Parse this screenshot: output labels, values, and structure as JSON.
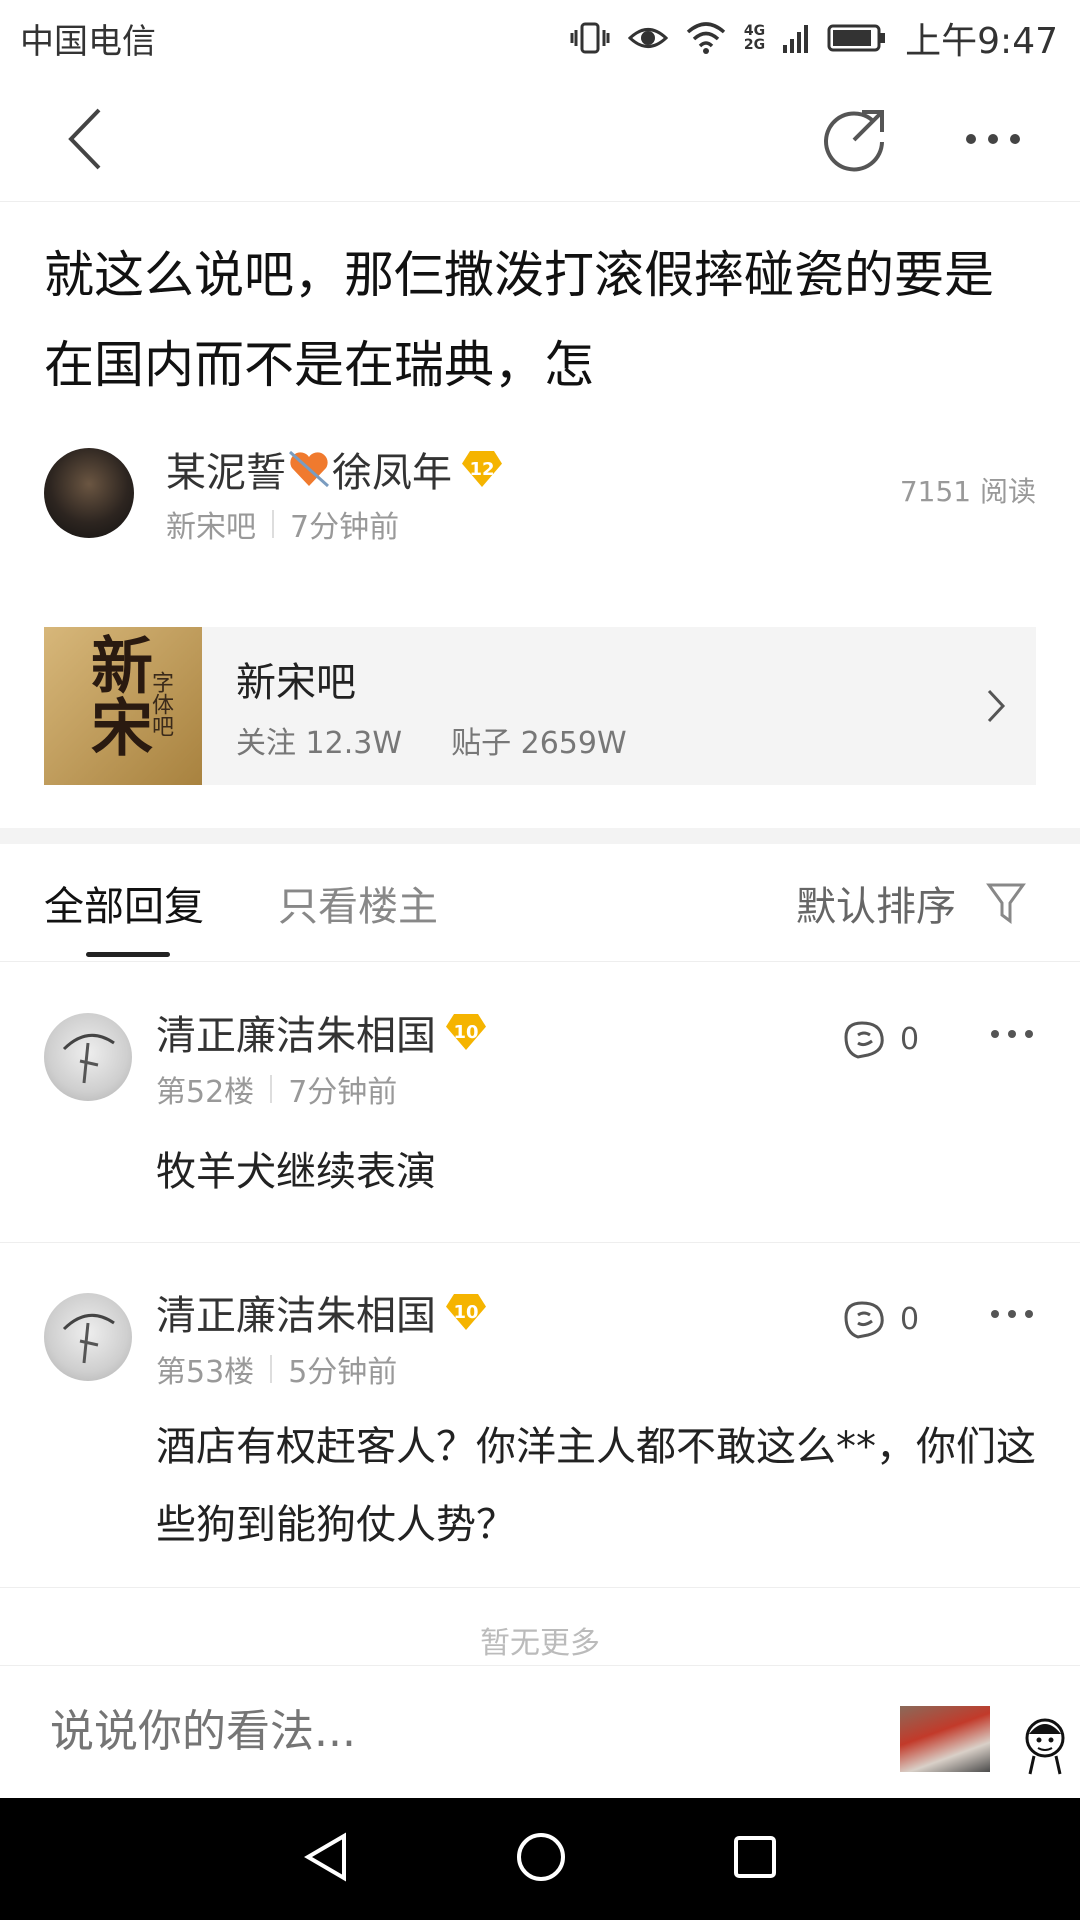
{
  "status_bar": {
    "carrier": "中国电信",
    "net": "4G\n2G",
    "time": "上午9:47"
  },
  "nav": {
    "back_icon": "chevron-left-icon",
    "share_icon": "share-icon",
    "more_icon": "more-icon"
  },
  "post": {
    "title": "就这么说吧，那仨撒泼打滚假摔碰瓷的要是在国内而不是在瑞典，怎",
    "author": {
      "name_part1": "某泥誓",
      "name_part2": "徐凤年",
      "level": "12"
    },
    "forum": "新宋吧",
    "time": "7分钟前",
    "reads": "7151 阅读"
  },
  "forum_card": {
    "name": "新宋吧",
    "followers": "关注 12.3W",
    "posts": "贴子 2659W",
    "cover_text": "新宋",
    "cover_sub": "字体吧"
  },
  "tabs": {
    "all_replies": "全部回复",
    "only_op": "只看楼主",
    "sort": "默认排序"
  },
  "replies": [
    {
      "name": "清正廉洁朱相国",
      "level": "10",
      "floor": "第52楼",
      "time": "7分钟前",
      "likes": "0",
      "text": "牧羊犬继续表演"
    },
    {
      "name": "清正廉洁朱相国",
      "level": "10",
      "floor": "第53楼",
      "time": "5分钟前",
      "likes": "0",
      "text": "酒店有权赶客人？你洋主人都不敢这么**，你们这些狗到能狗仗人势？"
    }
  ],
  "footer": {
    "no_more": "暂无更多",
    "input_placeholder": "说说你的看法..."
  },
  "colors": {
    "badge": "#f5b400",
    "separator": "#f3f3f3",
    "tab_indicator": "#222222"
  }
}
